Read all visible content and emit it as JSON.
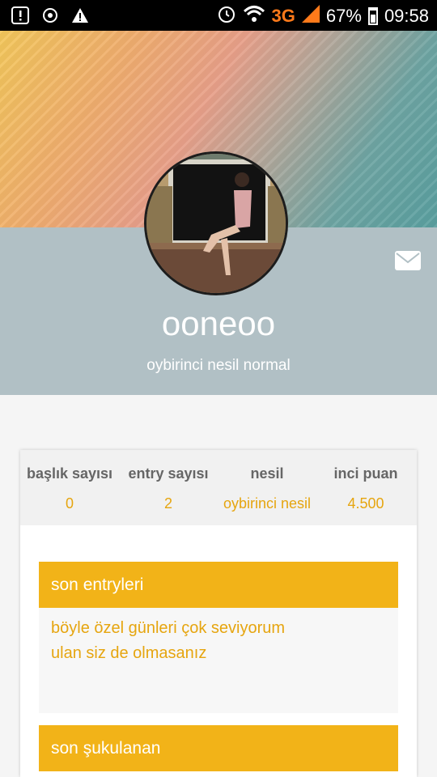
{
  "status_bar": {
    "network": "3G",
    "battery": "67%",
    "time": "09:58"
  },
  "profile": {
    "username": "ooneoo",
    "subtitle": "oybirinci nesil normal"
  },
  "stats": [
    {
      "label": "başlık sayısı",
      "value": "0"
    },
    {
      "label": "entry sayısı",
      "value": "2"
    },
    {
      "label": "nesil",
      "value": "oybirinci nesil"
    },
    {
      "label": "inci puan",
      "value": "4.500"
    }
  ],
  "sections": {
    "recent_entries": {
      "title": "son entryleri",
      "entry_line1": "böyle özel günleri çok seviyorum",
      "entry_line2": "ulan siz de olmasanız"
    },
    "recent_likes": {
      "title": "son şukulanan"
    }
  },
  "icons": {
    "mail": "mail-icon",
    "alarm": "alarm-icon",
    "wifi": "wifi-icon",
    "signal": "signal-icon"
  },
  "colors": {
    "accent": "#f2b318",
    "accent_text": "#e6a50f",
    "profile_band": "#b1c0c5"
  }
}
